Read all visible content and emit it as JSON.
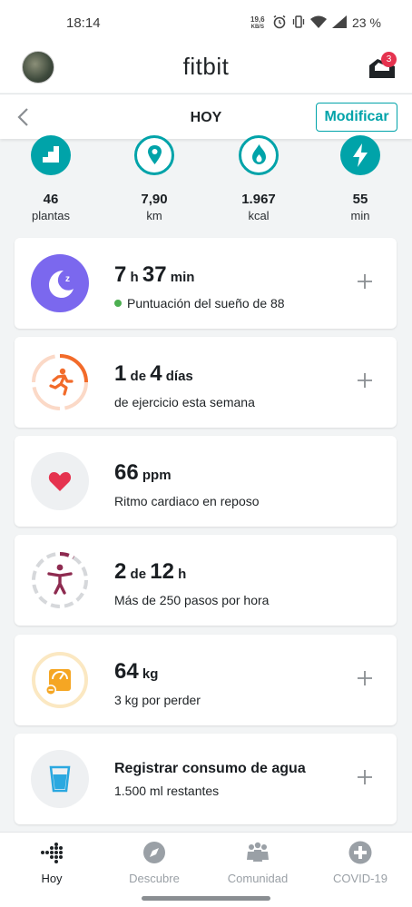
{
  "status_bar": {
    "time": "18:14",
    "net_speed": "19,6",
    "net_unit": "KB/S",
    "battery": "23 %"
  },
  "app_bar": {
    "brand": "fitbit",
    "notification_count": "3"
  },
  "sub_bar": {
    "title": "HOY",
    "modify_label": "Modificar"
  },
  "stats": [
    {
      "icon": "stairs-icon",
      "value": "46",
      "unit": "plantas"
    },
    {
      "icon": "location-pin-icon",
      "value": "7,90",
      "unit": "km"
    },
    {
      "icon": "flame-icon",
      "value": "1.967",
      "unit": "kcal"
    },
    {
      "icon": "lightning-icon",
      "value": "55",
      "unit": "min"
    }
  ],
  "cards": {
    "sleep": {
      "hours": "7",
      "h_unit": "h",
      "minutes": "37",
      "min_unit": "min",
      "subtitle": "Puntuación del sueño de 88"
    },
    "exercise": {
      "done": "1",
      "of": "de",
      "total": "4",
      "unit": "días",
      "subtitle": "de ejercicio esta semana"
    },
    "heart": {
      "value": "66",
      "unit": "ppm",
      "subtitle": "Ritmo cardiaco en reposo"
    },
    "hourly": {
      "done": "2",
      "of": "de",
      "total": "12",
      "unit": "h",
      "subtitle": "Más de 250 pasos por hora"
    },
    "weight": {
      "value": "64",
      "unit": "kg",
      "subtitle": "3 kg por perder"
    },
    "water": {
      "title": "Registrar consumo de agua",
      "subtitle": "1.500 ml restantes"
    }
  },
  "bottom_nav": [
    {
      "label": "Hoy",
      "active": true
    },
    {
      "label": "Descubre",
      "active": false
    },
    {
      "label": "Comunidad",
      "active": false
    },
    {
      "label": "COVID-19",
      "active": false
    }
  ],
  "colors": {
    "accent": "#00a3a9",
    "sleep": "#7b68ee",
    "exercise": "#f26b2a",
    "heart": "#e5334f",
    "hourly": "#8e2b50",
    "weight": "#f5a623",
    "water": "#2aa8e0"
  }
}
